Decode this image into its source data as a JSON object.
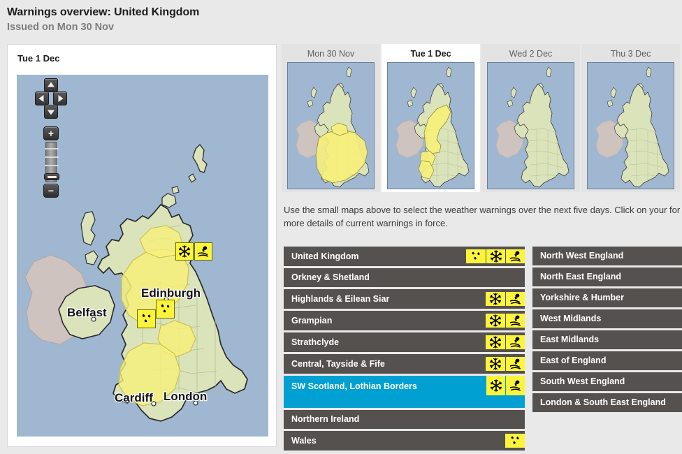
{
  "header": {
    "title": "Warnings overview: United Kingdom",
    "subtitle": "Issued on Mon 30 Nov"
  },
  "map_panel": {
    "title": "Tue 1 Dec",
    "controls": {
      "pan_up": "pan-up",
      "pan_left": "pan-left",
      "pan_right": "pan-right",
      "pan_down": "pan-down",
      "zoom_in": "+",
      "zoom_out": "−"
    },
    "city_labels": [
      "Edinburgh",
      "Belfast",
      "Cardiff",
      "London"
    ],
    "map_warning_badges": [
      {
        "icons": [
          "snow",
          "ice"
        ],
        "near": "Edinburgh"
      },
      {
        "icons": [
          "rain"
        ],
        "near": "Irish Sea / NW England"
      },
      {
        "icons": [
          "rain"
        ],
        "near": "North West England"
      }
    ],
    "colors": {
      "sea": "#9fb7d1",
      "land": "#dbe3bb",
      "land_outside_uk": "#c9bcbc",
      "warning_yellow": "#f7f07a",
      "border": "#2a2a2a"
    }
  },
  "day_thumbnails": [
    {
      "label": "Mon 30 Nov",
      "active": false,
      "has_warning": true,
      "warning_shape": "england-wales-large"
    },
    {
      "label": "Tue 1 Dec",
      "active": true,
      "has_warning": true,
      "warning_shape": "scotland-wales-band"
    },
    {
      "label": "Wed 2 Dec",
      "active": false,
      "has_warning": false,
      "warning_shape": "none"
    },
    {
      "label": "Thu 3 Dec",
      "active": false,
      "has_warning": false,
      "warning_shape": "none"
    }
  ],
  "helper_text": "Use the small maps above to select the weather warnings over the next five days. Click on your for more details of current warnings in force.",
  "regions": {
    "left_column": [
      {
        "name": "United Kingdom",
        "icons": [
          "rain",
          "snow",
          "ice"
        ],
        "selected": false,
        "tall": false
      },
      {
        "name": "Orkney & Shetland",
        "icons": [],
        "selected": false,
        "tall": false
      },
      {
        "name": "Highlands & Eilean Siar",
        "icons": [
          "snow",
          "ice"
        ],
        "selected": false,
        "tall": false
      },
      {
        "name": "Grampian",
        "icons": [
          "snow",
          "ice"
        ],
        "selected": false,
        "tall": false
      },
      {
        "name": "Strathclyde",
        "icons": [
          "snow",
          "ice"
        ],
        "selected": false,
        "tall": false
      },
      {
        "name": "Central, Tayside & Fife",
        "icons": [
          "snow",
          "ice"
        ],
        "selected": false,
        "tall": false
      },
      {
        "name": "SW Scotland, Lothian Borders",
        "icons": [
          "snow",
          "ice"
        ],
        "selected": true,
        "tall": true
      },
      {
        "name": "Northern Ireland",
        "icons": [],
        "selected": false,
        "tall": false
      },
      {
        "name": "Wales",
        "icons": [
          "rain"
        ],
        "selected": false,
        "tall": false
      }
    ],
    "right_column": [
      {
        "name": "North West England",
        "icons": [],
        "selected": false
      },
      {
        "name": "North East England",
        "icons": [],
        "selected": false
      },
      {
        "name": "Yorkshire & Humber",
        "icons": [],
        "selected": false
      },
      {
        "name": "West Midlands",
        "icons": [],
        "selected": false
      },
      {
        "name": "East Midlands",
        "icons": [],
        "selected": false
      },
      {
        "name": "East of England",
        "icons": [],
        "selected": false
      },
      {
        "name": "South West England",
        "icons": [],
        "selected": false
      },
      {
        "name": "London & South East England",
        "icons": [],
        "selected": false
      }
    ]
  },
  "icon_names": {
    "rain": "rain-icon",
    "snow": "snow-icon",
    "ice": "ice-icon"
  },
  "colors": {
    "row_background": "#55514e",
    "row_selected": "#00a0d2",
    "warning_badge": "#fbf43c",
    "page_background": "#e9e9e9",
    "title_text": "#1c1c1c",
    "subtitle_text": "#7d7d7d"
  }
}
